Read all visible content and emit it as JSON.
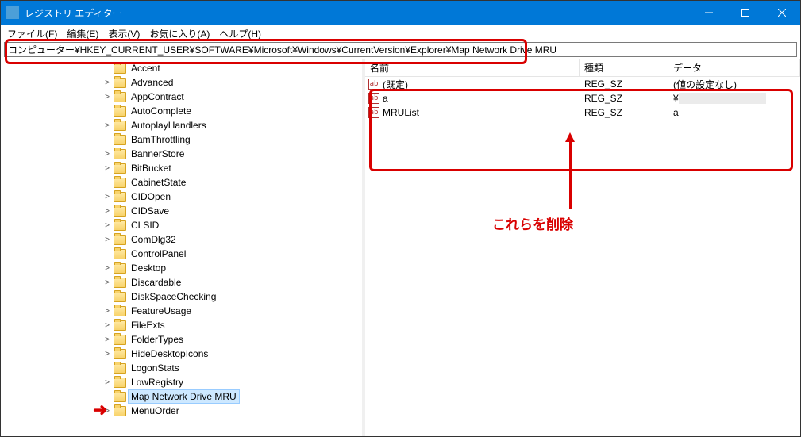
{
  "window": {
    "title": "レジストリ エディター"
  },
  "menu": {
    "file": "ファイル(F)",
    "edit": "編集(E)",
    "view": "表示(V)",
    "fav": "お気に入り(A)",
    "help": "ヘルプ(H)"
  },
  "address": {
    "path": "コンピューター¥HKEY_CURRENT_USER¥SOFTWARE¥Microsoft¥Windows¥CurrentVersion¥Explorer¥Map Network Drive MRU"
  },
  "tree": {
    "items": [
      {
        "label": "Accent",
        "exp": ""
      },
      {
        "label": "Advanced",
        "exp": ">"
      },
      {
        "label": "AppContract",
        "exp": ">"
      },
      {
        "label": "AutoComplete",
        "exp": ""
      },
      {
        "label": "AutoplayHandlers",
        "exp": ">"
      },
      {
        "label": "BamThrottling",
        "exp": ""
      },
      {
        "label": "BannerStore",
        "exp": ">"
      },
      {
        "label": "BitBucket",
        "exp": ">"
      },
      {
        "label": "CabinetState",
        "exp": ""
      },
      {
        "label": "CIDOpen",
        "exp": ">"
      },
      {
        "label": "CIDSave",
        "exp": ">"
      },
      {
        "label": "CLSID",
        "exp": ">"
      },
      {
        "label": "ComDlg32",
        "exp": ">"
      },
      {
        "label": "ControlPanel",
        "exp": ""
      },
      {
        "label": "Desktop",
        "exp": ">"
      },
      {
        "label": "Discardable",
        "exp": ">"
      },
      {
        "label": "DiskSpaceChecking",
        "exp": ""
      },
      {
        "label": "FeatureUsage",
        "exp": ">"
      },
      {
        "label": "FileExts",
        "exp": ">"
      },
      {
        "label": "FolderTypes",
        "exp": ">"
      },
      {
        "label": "HideDesktopIcons",
        "exp": ">"
      },
      {
        "label": "LogonStats",
        "exp": ""
      },
      {
        "label": "LowRegistry",
        "exp": ">"
      },
      {
        "label": "Map Network Drive MRU",
        "exp": "",
        "selected": true
      },
      {
        "label": "MenuOrder",
        "exp": ">"
      }
    ]
  },
  "list": {
    "headers": {
      "name": "名前",
      "type": "種類",
      "data": "データ"
    },
    "rows": [
      {
        "name": "(既定)",
        "type": "REG_SZ",
        "data": "(値の設定なし)"
      },
      {
        "name": "a",
        "type": "REG_SZ",
        "data": "¥"
      },
      {
        "name": "MRUList",
        "type": "REG_SZ",
        "data": "a"
      }
    ]
  },
  "annotations": {
    "delete_these": "これらを削除"
  }
}
